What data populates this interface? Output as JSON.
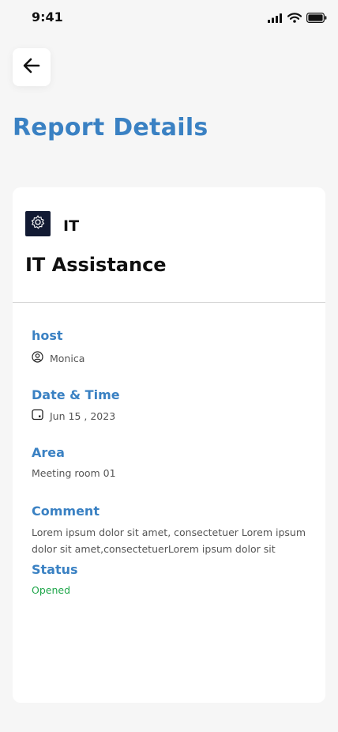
{
  "status_bar": {
    "time": "9:41",
    "icons": [
      "signal-icon",
      "wifi-icon",
      "battery-icon"
    ]
  },
  "header": {
    "back_icon": "arrow-left-icon",
    "title": "Report Details"
  },
  "report": {
    "department_icon": "settings-gear-icon",
    "department": "IT",
    "title": "IT Assistance",
    "host_label": "host",
    "host_icon": "user-circle-icon",
    "host_value": "Monica",
    "datetime_label": "Date & Time",
    "datetime_icon": "calendar-icon",
    "datetime_value": "Jun 15 , 2023",
    "area_label": "Area",
    "area_value": "Meeting room 01",
    "comment_label": "Comment",
    "comment_value": "Lorem ipsum dolor sit amet, consectetuer Lorem ipsum dolor sit amet,consectetuerLorem ipsum dolor sit",
    "status_label": "Status",
    "status_value": "Opened"
  },
  "colors": {
    "accent": "#3a81c3",
    "status_opened": "#1ea64a",
    "background": "#f6f6f6",
    "card": "#ffffff",
    "department_icon_bg": "#121a33"
  }
}
